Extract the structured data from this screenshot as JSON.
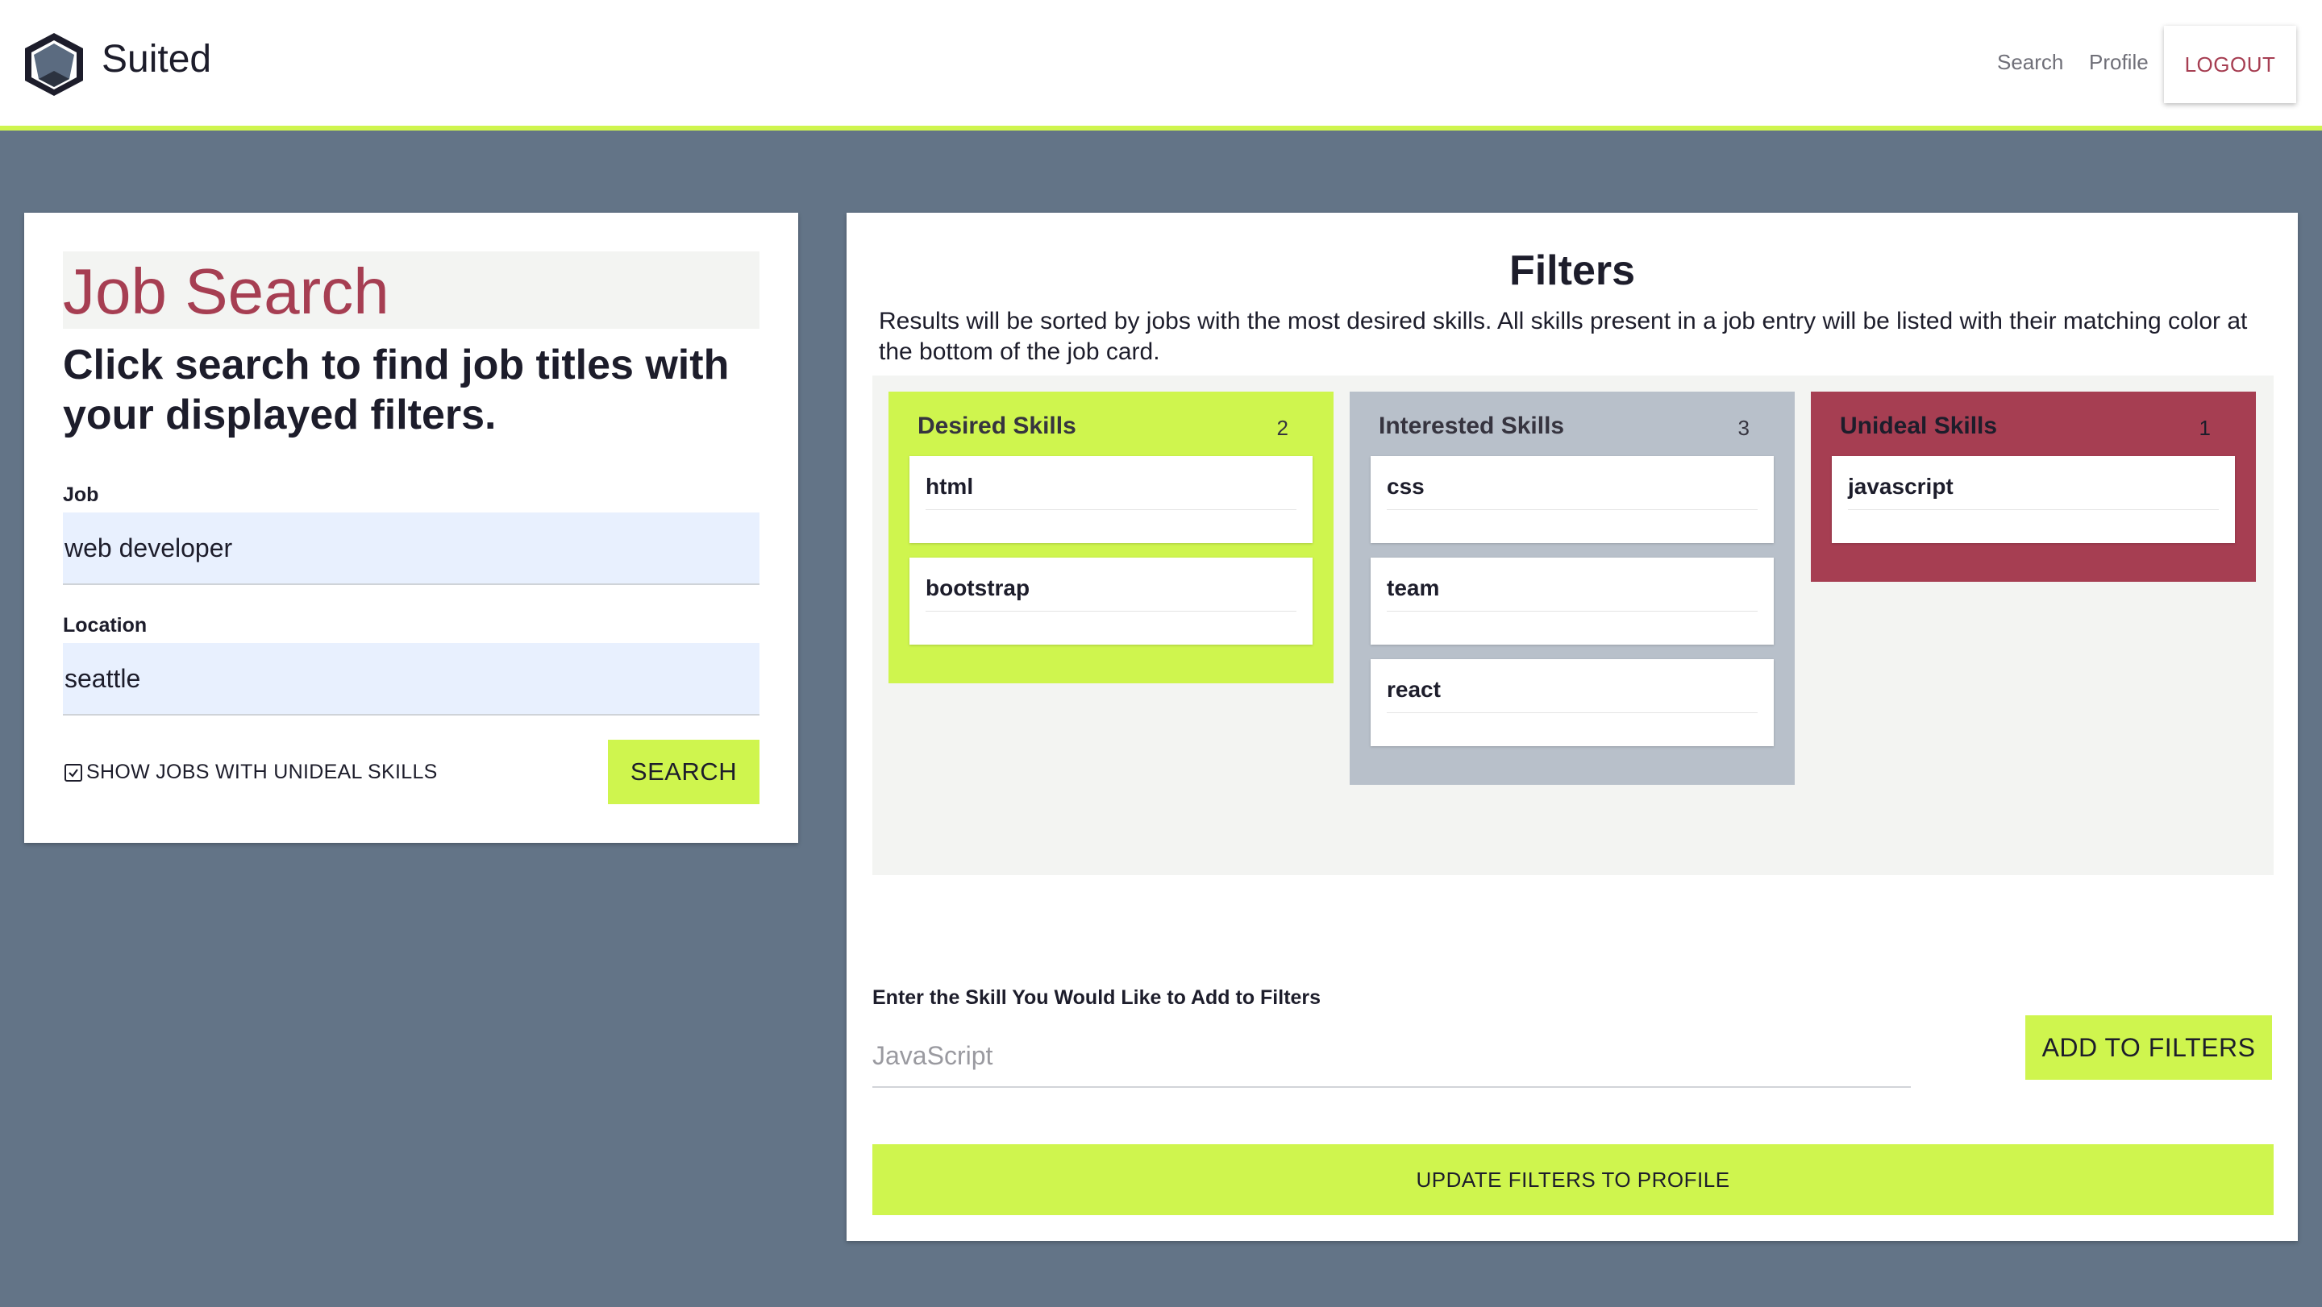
{
  "header": {
    "brand": "Suited",
    "nav": {
      "search": "Search",
      "profile": "Profile",
      "logout": "LOGOUT"
    }
  },
  "job_search": {
    "title": "Job Search",
    "subtitle": "Click search to find job titles with your displayed filters.",
    "job_label": "Job",
    "job_value": "web developer",
    "location_label": "Location",
    "location_value": "seattle",
    "show_unideal_label": "SHOW JOBS WITH UNIDEAL SKILLS",
    "search_button": "SEARCH"
  },
  "filters": {
    "title": "Filters",
    "description": "Results will be sorted by jobs with the most desired skills. All skills present in a job entry will be listed with their matching color at the bottom of the job card.",
    "columns": [
      {
        "title": "Desired Skills",
        "count": "2",
        "skills": [
          "html",
          "bootstrap"
        ]
      },
      {
        "title": "Interested Skills",
        "count": "3",
        "skills": [
          "css",
          "team",
          "react"
        ]
      },
      {
        "title": "Unideal Skills",
        "count": "1",
        "skills": [
          "javascript"
        ]
      }
    ],
    "add_label": "Enter the Skill You Would Like to Add to Filters",
    "add_placeholder": "JavaScript",
    "add_button": "ADD TO FILTERS",
    "update_button": "UPDATE FILTERS TO PROFILE"
  },
  "colors": {
    "accent": "#cff54e",
    "brand_red": "#a63e52",
    "interested_gray": "#b8c0ca",
    "background": "#637487"
  },
  "icons": {
    "logo": "hexagon-logo-icon",
    "checkbox": "checkbox-checked-icon"
  }
}
